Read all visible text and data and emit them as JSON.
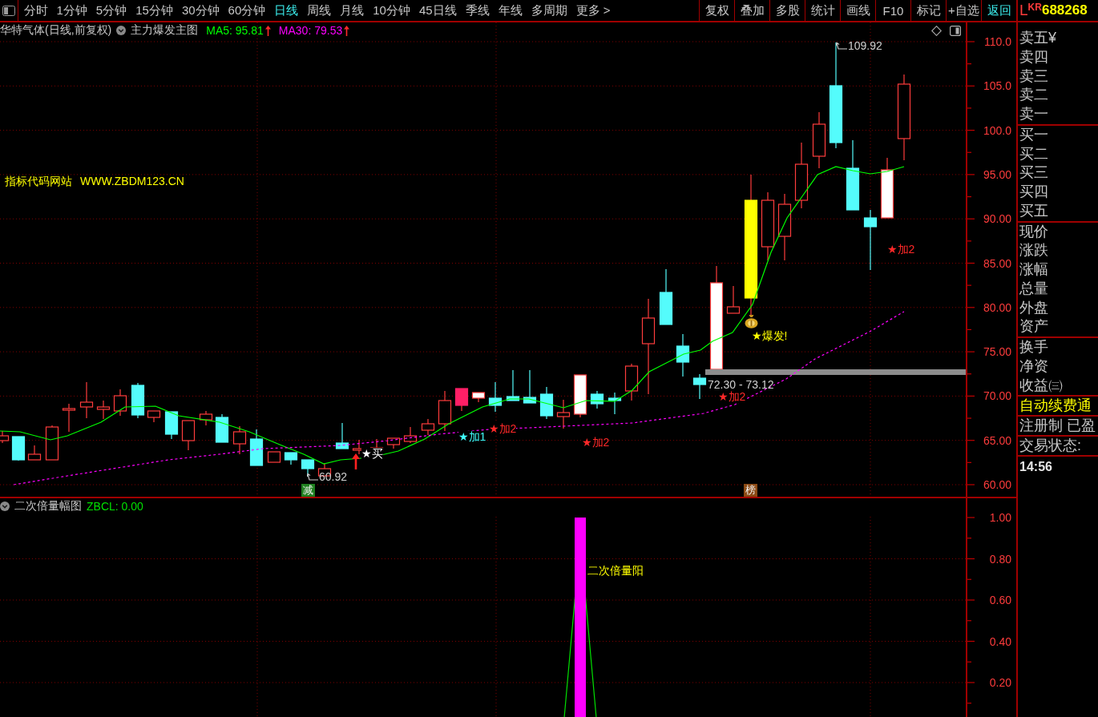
{
  "toolbar": {
    "periods": [
      {
        "label": "分时",
        "selected": false
      },
      {
        "label": "1分钟",
        "selected": false
      },
      {
        "label": "5分钟",
        "selected": false
      },
      {
        "label": "15分钟",
        "selected": false
      },
      {
        "label": "30分钟",
        "selected": false
      },
      {
        "label": "60分钟",
        "selected": false
      },
      {
        "label": "日线",
        "selected": true
      },
      {
        "label": "周线",
        "selected": false
      },
      {
        "label": "月线",
        "selected": false
      },
      {
        "label": "10分钟",
        "selected": false
      },
      {
        "label": "45日线",
        "selected": false
      },
      {
        "label": "季线",
        "selected": false
      },
      {
        "label": "年线",
        "selected": false
      },
      {
        "label": "多周期",
        "selected": false
      }
    ],
    "more": "更多 >",
    "buttons": [
      {
        "label": "复权",
        "kind": "normal"
      },
      {
        "label": "叠加",
        "kind": "normal"
      },
      {
        "label": "多股",
        "kind": "normal"
      },
      {
        "label": "统计",
        "kind": "normal"
      },
      {
        "label": "画线",
        "kind": "normal"
      },
      {
        "label": "F10",
        "kind": "normal"
      },
      {
        "label": "标记",
        "kind": "normal"
      },
      {
        "label": "+自选",
        "kind": "normal"
      },
      {
        "label": "返回",
        "kind": "accent"
      }
    ]
  },
  "stock": {
    "prefix": "L",
    "tag": "KR",
    "code": "688268"
  },
  "price_chart": {
    "title": "华特气体(日线,前复权)",
    "indicator": "主力爆发主图",
    "averages": [
      {
        "label": "MA5: 95.81",
        "rising": true,
        "color": "#00ff00"
      },
      {
        "label": "MA30: 79.53",
        "rising": true,
        "color": "#ff00ff"
      }
    ],
    "site_name": "指标代码网站",
    "site_url": "WWW.ZBDM123.CN",
    "extremes": [
      {
        "kind": "high",
        "label": "109.92"
      },
      {
        "kind": "low",
        "label": "60.92"
      }
    ],
    "signals": [
      {
        "label": "★买",
        "color": "#ffffff"
      },
      {
        "label": "★加1",
        "color": "#40ffff"
      },
      {
        "label": "★加2",
        "color": "#ff2828"
      },
      {
        "label": "★加2",
        "color": "#ff2828"
      },
      {
        "label": "★加2",
        "color": "#ff2828"
      },
      {
        "label": "★爆发!",
        "color": "#ffff00"
      },
      {
        "label": "★加2",
        "color": "#ff2828"
      }
    ],
    "range_label": "72.30 - 73.12",
    "tags": [
      {
        "label": "减",
        "color": "#1f7f1f"
      },
      {
        "label": "榜",
        "color": "#8c4a14"
      }
    ],
    "axis_labels": [
      "110.0",
      "105.0",
      "100.0",
      "95.00",
      "90.00",
      "85.00",
      "80.00",
      "75.00",
      "70.00",
      "65.00",
      "60.00"
    ]
  },
  "indicator_chart": {
    "title": "二次倍量幅图",
    "value": "ZBCL: 0.00",
    "signal": "二次倍量阳",
    "axis_labels": [
      "1.00",
      "0.80",
      "0.60",
      "0.40",
      "0.20"
    ]
  },
  "quote_panel": {
    "sections": [
      {
        "labels": [
          "卖五¥",
          "卖四",
          "卖三",
          "卖二",
          "卖一"
        ]
      },
      {
        "labels": [
          "买一",
          "买二",
          "买三",
          "买四",
          "买五"
        ]
      },
      {
        "labels": [
          "现价",
          "涨跌",
          "涨幅",
          "总量",
          "外盘",
          "资产"
        ]
      },
      {
        "labels": [
          "换手",
          "净资",
          "收益㈢"
        ]
      }
    ],
    "notices": [
      {
        "kind": "promo",
        "text": "自动续费通"
      },
      {
        "kind": "info",
        "text": "注册制 已盈"
      },
      {
        "kind": "info",
        "text": "交易状态:"
      }
    ],
    "time": "14:56"
  }
}
